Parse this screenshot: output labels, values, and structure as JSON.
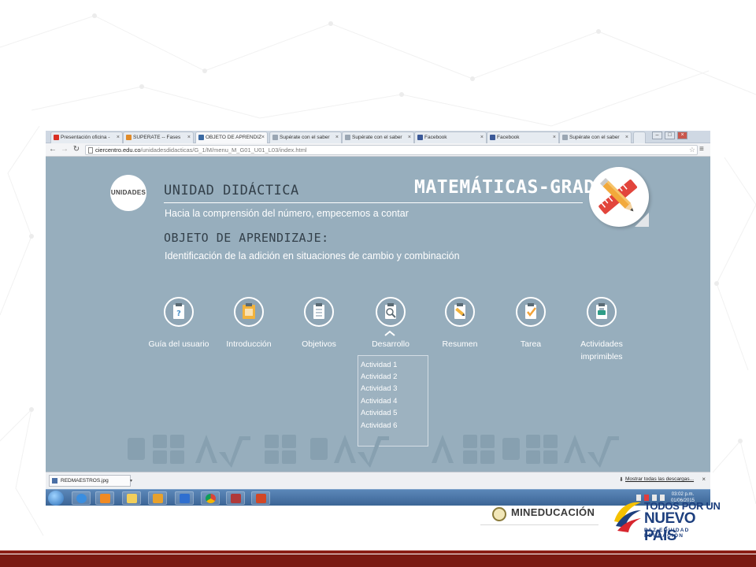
{
  "browser": {
    "tabs": [
      {
        "label": "Presentación oficina -",
        "icon": "gmail-icon",
        "color": "#d93025"
      },
      {
        "label": "SUPERATE -- Fases",
        "icon": "superate-icon",
        "color": "#e08b2a"
      },
      {
        "label": "OBJETO DE APRENDIZ",
        "icon": "page-icon",
        "color": "#3b6aa3",
        "active": true
      },
      {
        "label": "Supérate con el saber",
        "icon": "page-icon",
        "color": "#9aa6b3"
      },
      {
        "label": "Supérate con el saber",
        "icon": "page-icon",
        "color": "#9aa6b3"
      },
      {
        "label": "Facebook",
        "icon": "facebook-icon",
        "color": "#3b5998"
      },
      {
        "label": "Facebook",
        "icon": "facebook-icon",
        "color": "#3b5998"
      },
      {
        "label": "Supérate con el saber",
        "icon": "page-icon",
        "color": "#9aa6b3"
      }
    ],
    "url_host": "ciercentro.edu.co",
    "url_path": "/unidadesdidacticas/G_1/M/menu_M_G01_U01_L03/index.html"
  },
  "page": {
    "unidades_label": "UNIDADES",
    "unidad_heading": "UNIDAD DIDÁCTICA",
    "subject_title": "MATEMÁTICAS-GRADO 1",
    "unidad_subtitle": "Hacia la comprensión del número, empecemos a contar",
    "objeto_heading": "OBJETO DE APRENDIZAJE:",
    "objeto_subtitle": "Identificación de la adición en situaciones de cambio y combinación",
    "nav": [
      {
        "label": "Guía del usuario",
        "icon": "help-clipboard-icon"
      },
      {
        "label": "Introducción",
        "icon": "folder-clipboard-icon"
      },
      {
        "label": "Objetivos",
        "icon": "checklist-clipboard-icon"
      },
      {
        "label": "Desarrollo",
        "icon": "magnifier-clipboard-icon"
      },
      {
        "label": "Resumen",
        "icon": "pencil-clipboard-icon"
      },
      {
        "label": "Tarea",
        "icon": "check-clipboard-icon"
      },
      {
        "label": "Actividades imprimibles",
        "icon": "printer-clipboard-icon"
      }
    ],
    "activities": [
      "Actividad 1",
      "Actividad 2",
      "Actividad 3",
      "Actividad 4",
      "Actividad 5",
      "Actividad 6"
    ]
  },
  "downloads": {
    "file": "REDMAESTROS.jpg",
    "show_all": "Mostrar todas las descargas..."
  },
  "taskbar": {
    "time": "03:02 p.m.",
    "date": "01/06/2015"
  },
  "logos": {
    "ministry": "MINEDUCACIÓN",
    "slogan_line1": "TODOS POR UN",
    "slogan_line2": "NUEVO PAÍS",
    "slogan_line3": "PAZ EQUIDAD EDUCACIÓN"
  },
  "colors": {
    "page_bg": "#97aebd",
    "band": "#7a1a12",
    "brand_blue": "#1d3f7e"
  }
}
